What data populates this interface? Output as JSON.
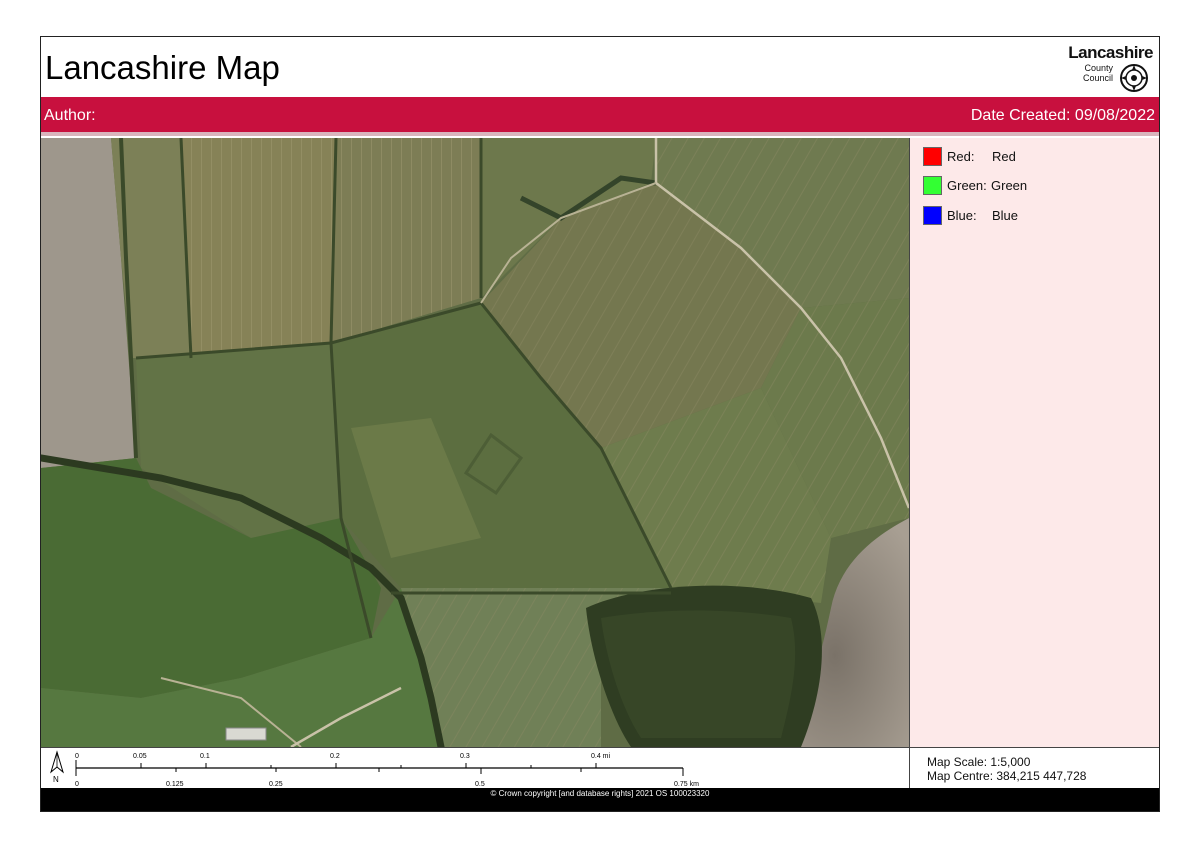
{
  "header": {
    "title": "Lancashire Map",
    "logo": {
      "word": "Lancashire",
      "line1": "County",
      "line2": "Council",
      "emblem": "rose-emblem-icon"
    }
  },
  "info_bar": {
    "author": "Author:",
    "date": "Date Created: 09/08/2022",
    "color": "#c8103e"
  },
  "legend": {
    "background": "#fde9e9",
    "items": [
      {
        "label": "Red:",
        "value": "Red",
        "color": "#ff0000"
      },
      {
        "label": "Green:",
        "value": "Green",
        "color": "#33ff33"
      },
      {
        "label": "Blue:",
        "value": "Blue",
        "color": "#0000ff"
      }
    ]
  },
  "scalebar": {
    "north_label": "N",
    "north_icon": "north-arrow-icon",
    "miles_labels": [
      "0",
      "0.05",
      "0.1",
      "0.2",
      "0.3",
      "0.4 mi"
    ],
    "km_labels": [
      "0",
      "0.125",
      "0.25",
      "0.5",
      "0.75 km"
    ]
  },
  "map_info": {
    "scale": "Map Scale: 1:5,000",
    "centre": "Map Centre: 384,215  447,728"
  },
  "footer": {
    "copyright": "© Crown copyright [and database rights] 2021 OS 100023320"
  }
}
